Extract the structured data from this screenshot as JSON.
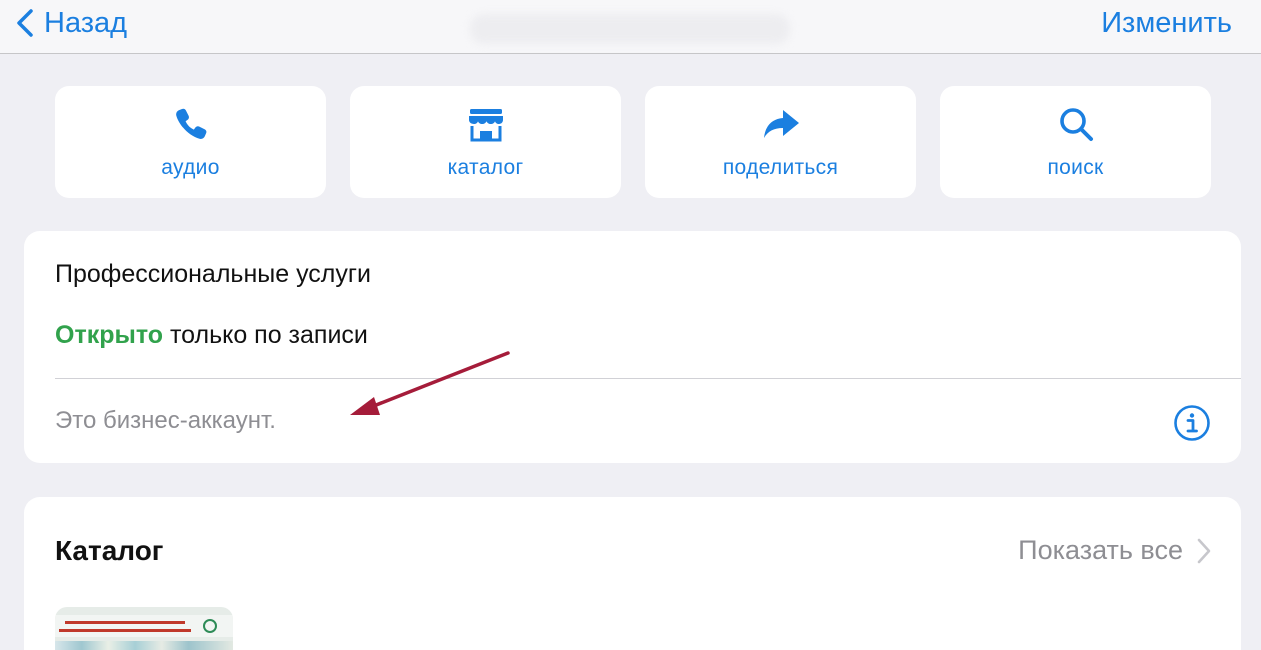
{
  "nav": {
    "back_label": "Назад",
    "edit_label": "Изменить"
  },
  "actions": [
    {
      "label": "аудио",
      "icon": "phone-icon"
    },
    {
      "label": "каталог",
      "icon": "storefront-icon"
    },
    {
      "label": "поделиться",
      "icon": "share-arrow-icon"
    },
    {
      "label": "поиск",
      "icon": "search-icon"
    }
  ],
  "info": {
    "category": "Профессиональные услуги",
    "open_status": "Открыто",
    "hours_suffix": " только по записи",
    "business_note": "Это бизнес-аккаунт."
  },
  "catalog": {
    "title": "Каталог",
    "show_all": "Показать все"
  },
  "colors": {
    "accent": "#1b7fe0",
    "open_green": "#31a24c",
    "secondary_text": "#8e8e93",
    "annotation_arrow": "#a51c3a",
    "background": "#efeff4"
  }
}
